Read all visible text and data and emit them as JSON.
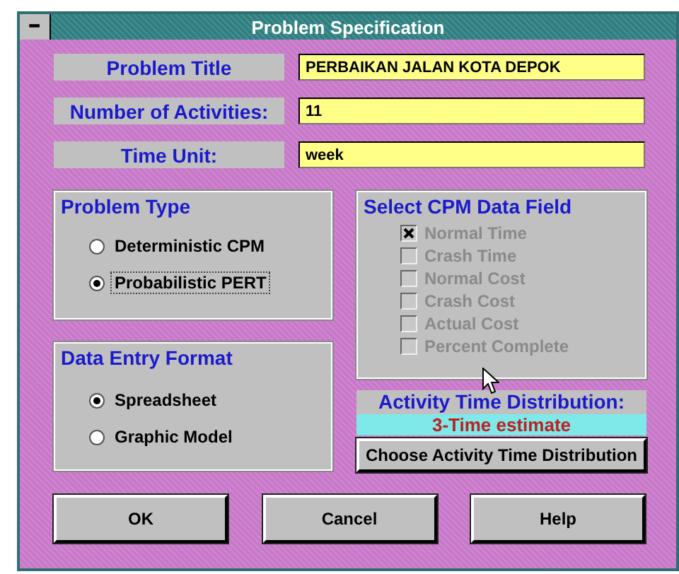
{
  "window": {
    "title": "Problem Specification",
    "menu_glyph": "━"
  },
  "fields": [
    {
      "label": "Problem Title",
      "value": "PERBAIKAN JALAN KOTA DEPOK"
    },
    {
      "label": "Number of Activities:",
      "value": "11"
    },
    {
      "label": "Time Unit:",
      "value": "week"
    }
  ],
  "problem_type": {
    "title": "Problem Type",
    "options": [
      {
        "label": "Deterministic CPM",
        "selected": false
      },
      {
        "label": "Probabilistic PERT",
        "selected": true
      }
    ]
  },
  "data_entry_format": {
    "title": "Data Entry Format",
    "options": [
      {
        "label": "Spreadsheet",
        "selected": true
      },
      {
        "label": "Graphic Model",
        "selected": false
      }
    ]
  },
  "cpm_data_field": {
    "title": "Select CPM Data Field",
    "disabled": true,
    "items": [
      {
        "label": "Normal Time",
        "checked": true
      },
      {
        "label": "Crash Time",
        "checked": false
      },
      {
        "label": "Normal Cost",
        "checked": false
      },
      {
        "label": "Crash Cost",
        "checked": false
      },
      {
        "label": "Actual Cost",
        "checked": false
      },
      {
        "label": "Percent Complete",
        "checked": false
      }
    ]
  },
  "activity_time_distribution": {
    "label": "Activity Time Distribution:",
    "value": "3-Time estimate",
    "button": "Choose Activity Time Distribution"
  },
  "buttons": [
    "OK",
    "Cancel",
    "Help"
  ]
}
